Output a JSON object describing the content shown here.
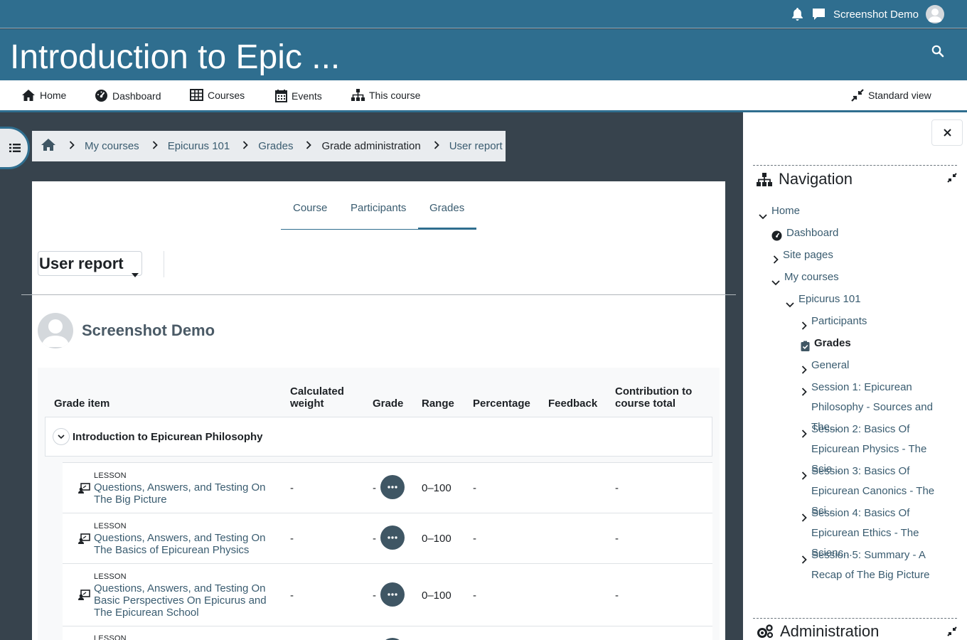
{
  "topbar": {
    "user_name": "Screenshot Demo",
    "icons": [
      "bell-icon",
      "message-icon"
    ]
  },
  "header": {
    "course_title": "Introduction to Epic ...",
    "search_icon": "search-icon"
  },
  "primary_nav": {
    "home": "Home",
    "dashboard": "Dashboard",
    "courses": "Courses",
    "events": "Events",
    "this_course": "This course",
    "standard_view": "Standard view"
  },
  "breadcrumb": {
    "items": [
      "My courses",
      "Epicurus 101",
      "Grades",
      "Grade administration",
      "User report"
    ]
  },
  "tabs": [
    "Course",
    "Participants",
    "Grades"
  ],
  "report_select": {
    "value": "User report"
  },
  "user": {
    "name": "Screenshot Demo"
  },
  "grade_table": {
    "headers": {
      "grade_item": "Grade item",
      "calculated_weight_1": "Calculated",
      "calculated_weight_2": "weight",
      "grade": "Grade",
      "range": "Range",
      "percentage": "Percentage",
      "feedback": "Feedback",
      "contribution_1": "Contribution to",
      "contribution_2": "course total"
    },
    "category": "Introduction to Epicurean Philosophy",
    "rows": [
      {
        "type": "LESSON",
        "name_line1": "Questions, Answers, and Testing On",
        "name_line2": "The Big Picture",
        "name_line3": "",
        "weight": "-",
        "grade": "-",
        "range": "0–100",
        "percentage": "-",
        "contribution": "-"
      },
      {
        "type": "LESSON",
        "name_line1": "Questions, Answers, and Testing On",
        "name_line2": "The Basics of Epicurean Physics",
        "name_line3": "",
        "weight": "-",
        "grade": "-",
        "range": "0–100",
        "percentage": "-",
        "contribution": "-"
      },
      {
        "type": "LESSON",
        "name_line1": "Questions, Answers, and Testing On",
        "name_line2": "Basic Perspectives On Epicurus and",
        "name_line3": "The Epicurean School",
        "weight": "-",
        "grade": "-",
        "range": "0–100",
        "percentage": "-",
        "contribution": "-"
      },
      {
        "type": "LESSON"
      }
    ]
  },
  "navigation_block": {
    "title": "Navigation",
    "items": {
      "home": "Home",
      "dashboard": "Dashboard",
      "site_pages": "Site pages",
      "my_courses": "My courses",
      "course": "Epicurus 101",
      "participants": "Participants",
      "grades": "Grades",
      "general": "General",
      "session1": "Session 1: Epicurean Philosophy - Sources and The...",
      "session2": "Session 2: Basics Of Epicurean Physics - The Scie...",
      "session3": "Session 3: Basics Of Epicurean Canonics - The Sci...",
      "session4": "Session 4: Basics Of Epicurean Ethics - The Scienc...",
      "session5": "Session 5: Summary - A Recap of The Big Picture"
    }
  },
  "administration_block": {
    "title": "Administration"
  },
  "colors": {
    "brand": "#2f6e8f",
    "page_bg": "#37434d",
    "link": "#3a5c70",
    "action_button": "#3f5664"
  }
}
